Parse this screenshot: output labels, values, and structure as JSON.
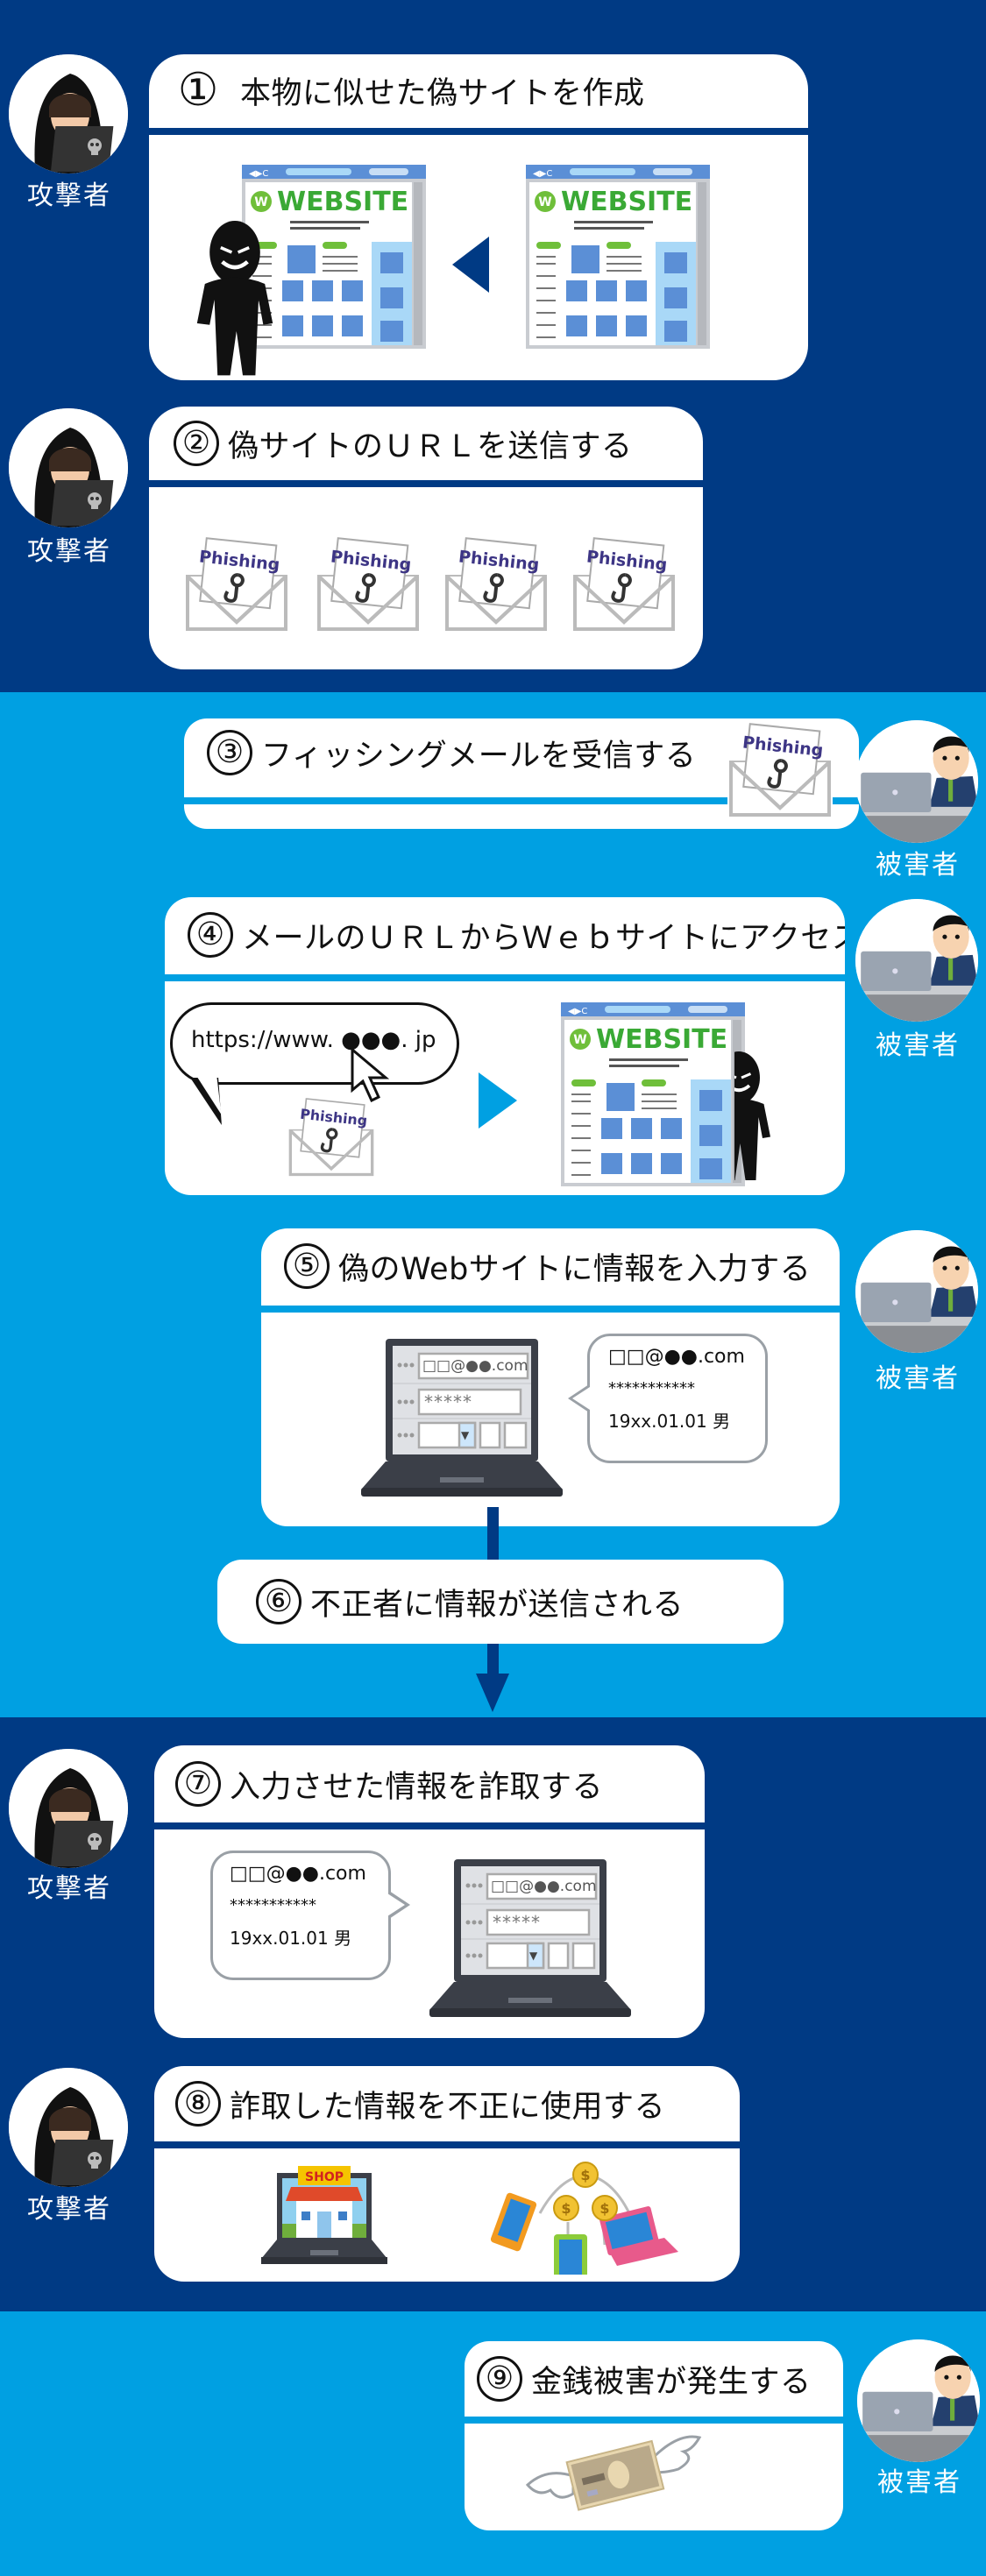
{
  "colors": {
    "dark_band": "#003a84",
    "light_band": "#00a0e2",
    "card": "#ffffff",
    "website_green": "#3aa935",
    "browser_blue": "#5b8fd6",
    "phishing_text": "#3d3585"
  },
  "roles": {
    "attacker": "攻撃者",
    "victim": "被害者"
  },
  "steps": [
    {
      "number": "①",
      "title": "本物に似せた偽サイトを作成",
      "actor": "attacker"
    },
    {
      "number": "②",
      "title": "偽サイトのＵＲＬを送信する",
      "actor": "attacker"
    },
    {
      "number": "③",
      "title": "フィッシングメールを受信する",
      "actor": "victim"
    },
    {
      "number": "④",
      "title": "メールのＵＲＬからＷｅｂサイトにアクセス",
      "actor": "victim"
    },
    {
      "number": "⑤",
      "title": "偽のWebサイトに情報を入力する",
      "actor": "victim"
    },
    {
      "number": "⑥",
      "title": "不正者に情報が送信される",
      "actor": "flow"
    },
    {
      "number": "⑦",
      "title": "入力させた情報を詐取する",
      "actor": "attacker"
    },
    {
      "number": "⑧",
      "title": "詐取した情報を不正に使用する",
      "actor": "attacker"
    },
    {
      "number": "⑨",
      "title": "金銭被害が発生する",
      "actor": "victim"
    }
  ],
  "website_logo": "WEBSITE",
  "website_logo_badge": "W",
  "phishing_label": "Phishing",
  "url_text": "https://www. ●●●. jp",
  "form": {
    "email": "□□@●●.com",
    "password": "*****",
    "dropdown_arrow": "▼"
  },
  "bubble": {
    "email": "□□@●●.com",
    "password": "***********",
    "birth_gender": "19xx.01.01 男"
  },
  "shop_sign": "SHOP",
  "coin_symbol": "$"
}
